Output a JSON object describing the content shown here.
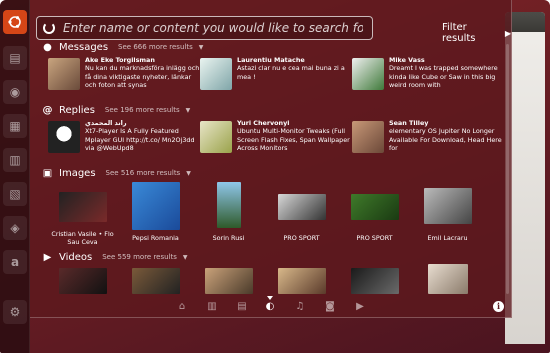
{
  "search": {
    "placeholder": "Enter name or content you would like to search for"
  },
  "filter": {
    "label": "Filter results"
  },
  "sections": {
    "messages": {
      "title": "Messages",
      "more": "See 666 more results",
      "icon": "speech-bubble-icon",
      "items": [
        {
          "name": "Ake Eke Torgilsman",
          "text": "Nu kan du marknadsföra inlägg och få dina viktigaste nyheter, länkar och foton att synas"
        },
        {
          "name": "Laurentiu Matache",
          "text": "Astazi clar nu e cea mai buna zi a mea !"
        },
        {
          "name": "Mike Vass",
          "text": "Dreamt I was trapped somewhere kinda like Cube or Saw in this big weird room with"
        }
      ]
    },
    "replies": {
      "title": "Replies",
      "more": "See 196 more results",
      "icon": "at-sign-icon",
      "items": [
        {
          "name": "راند المحمدي",
          "text": "Xt7-Player Is A Fully Featured Mplayer GUI http://t.co/ Mn2Oj3dd via @WebUpd8"
        },
        {
          "name": "Yuri Chervonyi",
          "text": "Ubuntu Multi-Monitor Tweaks (Full Screen Flash Fixes, Span Wallpaper Across Monitors"
        },
        {
          "name": "Sean Tilley",
          "text": "elementary OS Jupiter No Longer Available For Download, Head Here for"
        }
      ]
    },
    "images": {
      "title": "Images",
      "more": "See 516 more results",
      "icon": "photo-icon",
      "items": [
        {
          "label": "Cristian Vasile • Flo Sau Ceva"
        },
        {
          "label": "Pepsi Romania"
        },
        {
          "label": "Sorin Rusi"
        },
        {
          "label": "PRO SPORT"
        },
        {
          "label": "PRO SPORT"
        },
        {
          "label": "Emil Lacraru"
        }
      ]
    },
    "videos": {
      "title": "Videos",
      "more": "See 559 more results",
      "icon": "film-icon"
    }
  },
  "launcher": {
    "items": [
      "ubuntu-logo-icon",
      "files-icon",
      "browser-icon",
      "document-icon",
      "spreadsheet-icon",
      "presentation-icon",
      "software-center-icon",
      "amazon-icon",
      "settings-icon"
    ]
  },
  "lenses": [
    "home-icon",
    "applications-icon",
    "files-icon",
    "social-icon",
    "music-icon",
    "photos-icon",
    "video-icon"
  ],
  "colors": {
    "accent": "#d54617",
    "dash_bg": "#5c181e"
  }
}
